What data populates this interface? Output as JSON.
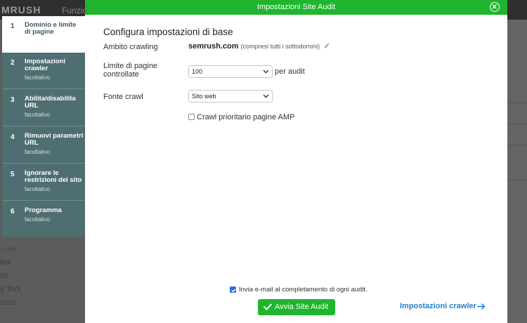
{
  "background": {
    "logo": "MRUSH",
    "menu_partial": "Funzio",
    "section_label": "LINK",
    "links": [
      "link",
      "dit",
      "g Tool",
      "occo"
    ]
  },
  "steps": [
    {
      "number": "1",
      "title": "Dominio e limite di pagine",
      "subtitle": "",
      "active": true
    },
    {
      "number": "2",
      "title": "Impostazioni crawler",
      "subtitle": "facoltativo",
      "active": false
    },
    {
      "number": "3",
      "title": "Abilita/disabilita URL",
      "subtitle": "facoltativo",
      "active": false
    },
    {
      "number": "4",
      "title": "Rimuovi parametri URL",
      "subtitle": "facoltativo",
      "active": false
    },
    {
      "number": "5",
      "title": "Ignorare le restrizioni del sito",
      "subtitle": "facoltativo",
      "active": false
    },
    {
      "number": "6",
      "title": "Programma",
      "subtitle": "facoltativo",
      "active": false
    }
  ],
  "modal": {
    "title": "Impostazioni Site Audit",
    "section_title": "Configura impostazioni di base",
    "scope_label": "Ambito crawling",
    "domain": "semrush.com",
    "domain_note": "(compresi tutti i sottodomini)",
    "limit_label": "Limite di pagine controllate",
    "limit_value": "100",
    "limit_suffix": "per audit",
    "source_label": "Fonte crawl",
    "source_value": "Sito web",
    "amp_label": "Crawl prioritario pagine AMP",
    "amp_checked": false,
    "email_label": "Invia e-mail al completamento di ogni audit.",
    "email_checked": true,
    "start_button": "Avvia Site Audit",
    "next_link": "Impostazioni crawler"
  },
  "colors": {
    "accent_green": "#1fb52e",
    "steps_bg": "#4f6e72",
    "link_blue": "#1f7fd1",
    "checkbox_blue": "#2a6fe0"
  }
}
